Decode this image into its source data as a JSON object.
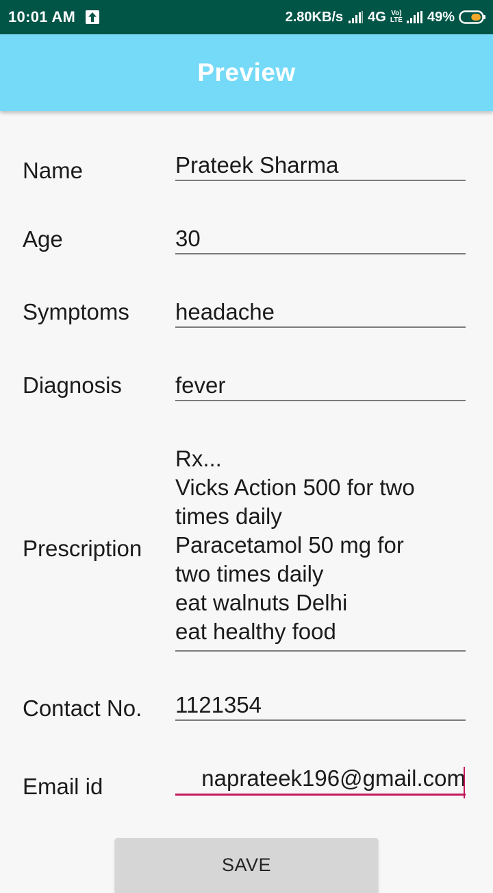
{
  "status_bar": {
    "time": "10:01 AM",
    "net_speed": "2.80KB/s",
    "network_type": "4G",
    "volte_top": "Vo)",
    "volte_bottom": "LTE",
    "battery_percent": "49%",
    "battery_level": 0.49,
    "icons": [
      "upload-icon",
      "signal-icon",
      "signal-icon",
      "battery-icon"
    ],
    "background_color": "#005547"
  },
  "app_bar": {
    "title": "Preview",
    "background_color": "#74daf7"
  },
  "form": {
    "name": {
      "label": "Name",
      "value": "Prateek Sharma"
    },
    "age": {
      "label": "Age",
      "value": "30"
    },
    "symptoms": {
      "label": "Symptoms",
      "value": "headache"
    },
    "diagnosis": {
      "label": "Diagnosis",
      "value": "fever"
    },
    "prescription": {
      "label": "Prescription",
      "value": "Rx...\nVicks Action 500 for two\ntimes daily\nParacetamol 50 mg for\ntwo times daily\neat walnuts Delhi\neat healthy food"
    },
    "contact": {
      "label": "Contact No.",
      "value": "1121354"
    },
    "email": {
      "label": "Email id",
      "value": "naprateek196@gmail.com"
    }
  },
  "save_button": {
    "label": "SAVE"
  },
  "accent_color": "#c2185b"
}
